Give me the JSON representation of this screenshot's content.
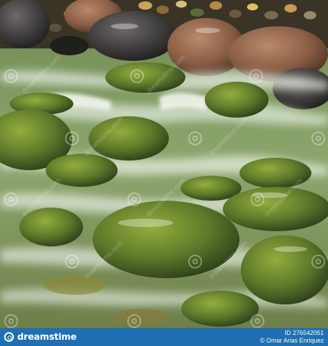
{
  "photo": {
    "subject": "river-stones-photo",
    "watermark_text": "dreamstime.com"
  },
  "footer": {
    "brand_name": "dreamstime",
    "image_id": "ID 276542051",
    "credit": "© Omar Arias Enriquez"
  },
  "colors": {
    "footer_bg": "#1f6fb2",
    "moss": "#7d9a3a",
    "water": "#c9d6c0"
  }
}
